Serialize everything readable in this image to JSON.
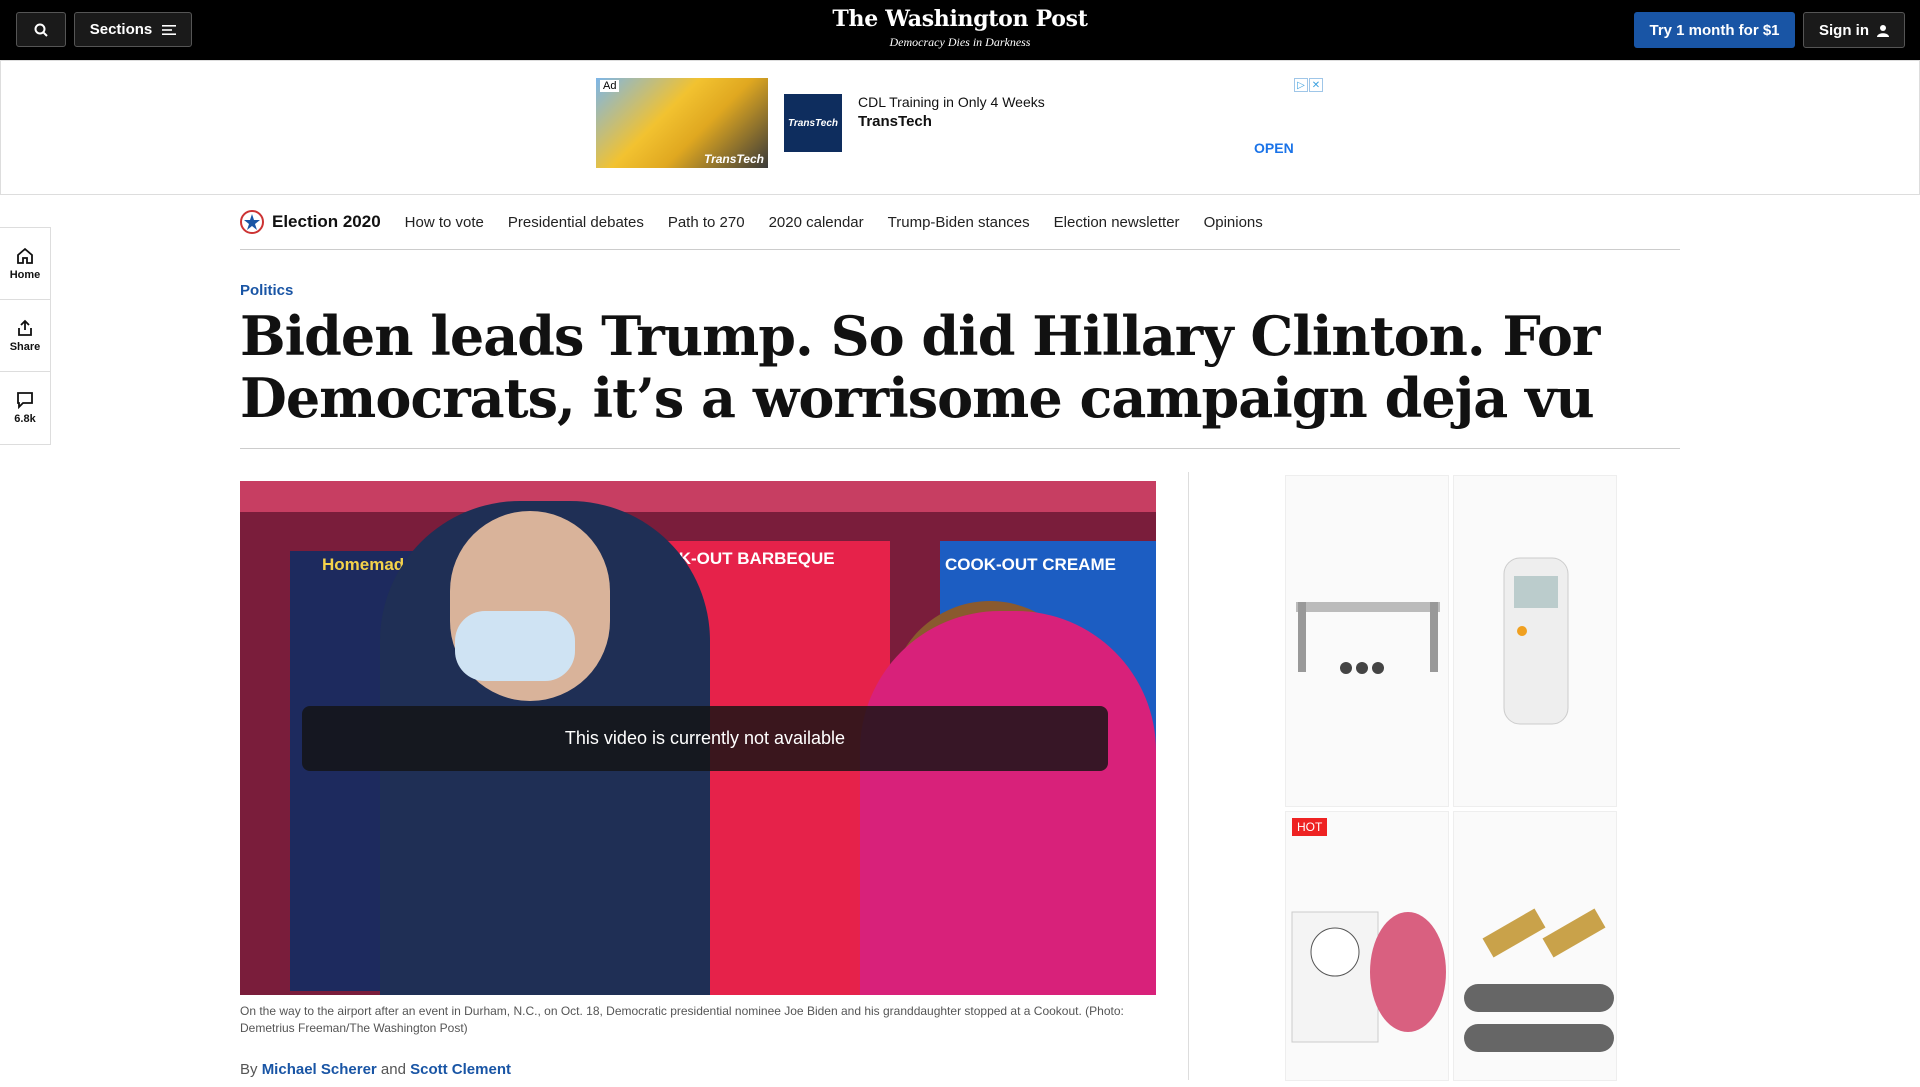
{
  "topbar": {
    "sections_label": "Sections",
    "brand": "The Washington Post",
    "tagline": "Democracy Dies in Darkness",
    "try_label": "Try 1 month for $1",
    "signin_label": "Sign in"
  },
  "ad": {
    "badge": "Ad",
    "image_watermark": "TransTech",
    "logo_text": "TransTech",
    "headline": "CDL Training in Only 4 Weeks",
    "advertiser": "TransTech",
    "cta": "OPEN"
  },
  "rail": {
    "home": "Home",
    "share": "Share",
    "comments": "6.8k"
  },
  "election_nav": {
    "brand": "Election 2020",
    "links": [
      "How to vote",
      "Presidential debates",
      "Path to 270",
      "2020 calendar",
      "Trump-Biden stances",
      "Election newsletter",
      "Opinions"
    ]
  },
  "article": {
    "kicker": "Politics",
    "headline": "Biden leads Trump. So did Hillary Clinton. For Democrats, it’s a worrisome campaign deja vu",
    "video_message": "This video is currently not available",
    "menu_title_left": "Homemade Ch",
    "menu_title_mid": "COOK-OUT BARBEQUE",
    "menu_title_right": "COOK-OUT CREAME",
    "caption": "On the way to the airport after an event in Durham, N.C., on Oct. 18, Democratic presidential nominee Joe Biden and his granddaughter stopped at a Cookout. (Photo: Demetrius Freeman/The Washington Post)",
    "byline_prefix": "By",
    "author1": "Michael Scherer",
    "byline_and": "and",
    "author2": "Scott Clement"
  },
  "side_ad": {
    "hot_badge": "HOT"
  },
  "colors": {
    "accent": "#1955a5",
    "topbar": "#000000"
  }
}
